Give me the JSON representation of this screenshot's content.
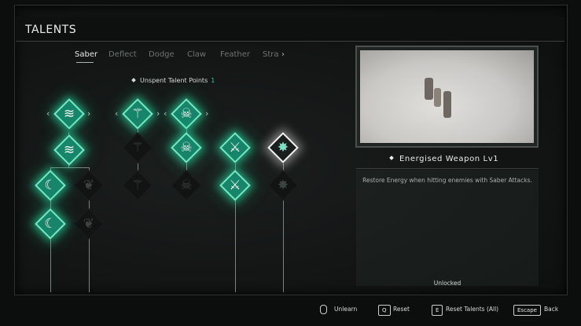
{
  "header": {
    "title": "TALENTS"
  },
  "tabs": [
    {
      "label": "Saber",
      "active": true
    },
    {
      "label": "Deflect"
    },
    {
      "label": "Dodge"
    },
    {
      "label": "Claw"
    },
    {
      "label": "Feather"
    },
    {
      "label": "Stra"
    }
  ],
  "tab_next_icon": "chevron-right-icon",
  "talent_points": {
    "label": "Unspent Talent Points",
    "value": "1"
  },
  "tree": {
    "accent_color": "#3ad6a6",
    "nodes": [
      {
        "id": "n1",
        "state": "active",
        "icon": "wind-slash-icon"
      },
      {
        "id": "n2",
        "state": "active",
        "icon": "leaf-blade-icon"
      },
      {
        "id": "n3",
        "state": "active",
        "icon": "skull-icon"
      },
      {
        "id": "n4",
        "state": "active",
        "icon": "wind-slash-icon"
      },
      {
        "id": "n5",
        "state": "locked",
        "icon": "leaf-blade-icon"
      },
      {
        "id": "n6",
        "state": "active",
        "icon": "skull-icon"
      },
      {
        "id": "n7",
        "state": "active",
        "icon": "sword-icon"
      },
      {
        "id": "n8",
        "state": "selected",
        "icon": "burst-icon"
      },
      {
        "id": "n9",
        "state": "active",
        "icon": "crescent-slash-icon"
      },
      {
        "id": "n10",
        "state": "locked",
        "icon": "feather-icon"
      },
      {
        "id": "n11",
        "state": "locked",
        "icon": "leaf-blade-icon"
      },
      {
        "id": "n12",
        "state": "locked",
        "icon": "skull-icon"
      },
      {
        "id": "n13",
        "state": "active",
        "icon": "sword-icon"
      },
      {
        "id": "n14",
        "state": "locked",
        "icon": "burst-icon"
      },
      {
        "id": "n15",
        "state": "active",
        "icon": "crescent-slash-icon"
      },
      {
        "id": "n16",
        "state": "locked",
        "icon": "feather-icon"
      }
    ]
  },
  "detail": {
    "skill_name": "Energised Weapon Lv1",
    "description": "Restore Energy when hitting enemies with Saber Attacks.",
    "status": "Unlocked",
    "preview_icon": "gameplay-preview-image"
  },
  "footer": {
    "unlearn": {
      "icon": "mouse-icon",
      "label": "Unlearn"
    },
    "reset": {
      "key": "Q",
      "label": "Reset"
    },
    "reset_all": {
      "key": "E",
      "label": "Reset Talents (All)"
    },
    "back": {
      "key": "Escape",
      "label": "Back"
    }
  }
}
